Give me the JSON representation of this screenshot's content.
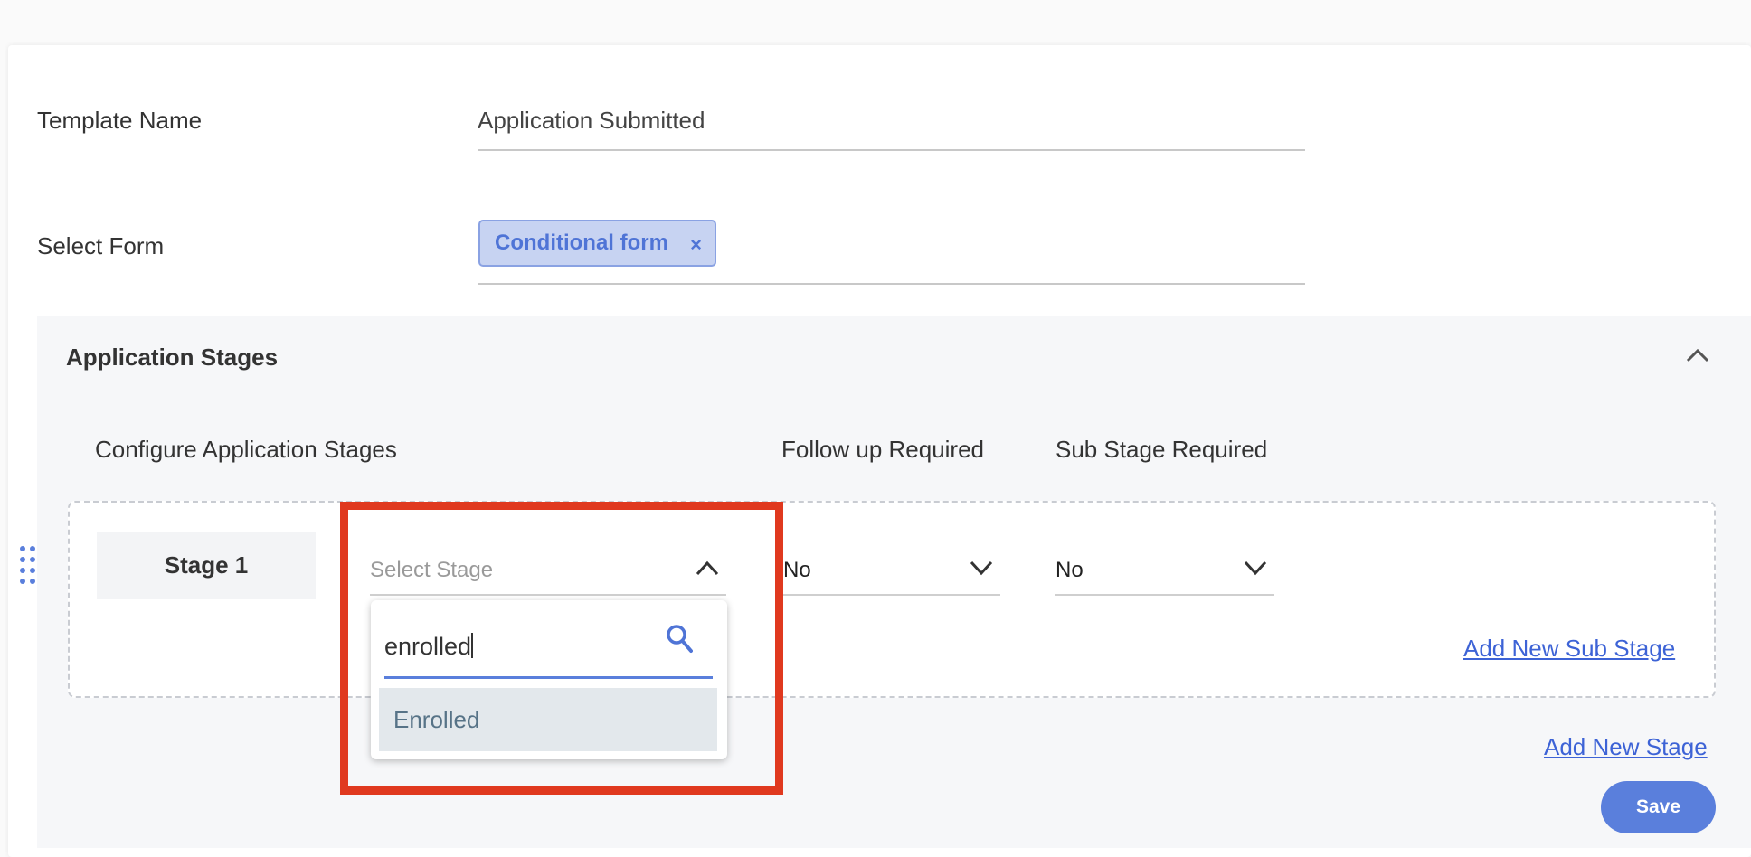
{
  "form": {
    "template_name_label": "Template Name",
    "template_name_value": "Application Submitted",
    "select_form_label": "Select Form",
    "selected_form_chip": "Conditional form",
    "chip_remove": "×"
  },
  "stages": {
    "title": "Application Stages",
    "col_configure": "Configure Application Stages",
    "col_followup": "Follow up Required",
    "col_substage": "Sub Stage Required",
    "row": {
      "stage_name": "Stage 1",
      "stage_select_placeholder": "Select Stage",
      "followup_value": "No",
      "substage_value": "No"
    },
    "add_sub_stage": "Add New Sub Stage",
    "add_stage": "Add New Stage",
    "save": "Save"
  },
  "dropdown": {
    "search_value": "enrolled",
    "options": [
      "Enrolled"
    ]
  },
  "colors": {
    "accent": "#5a7fdc",
    "chip_bg": "#c7d3f2",
    "highlight_border": "#e0391f"
  }
}
